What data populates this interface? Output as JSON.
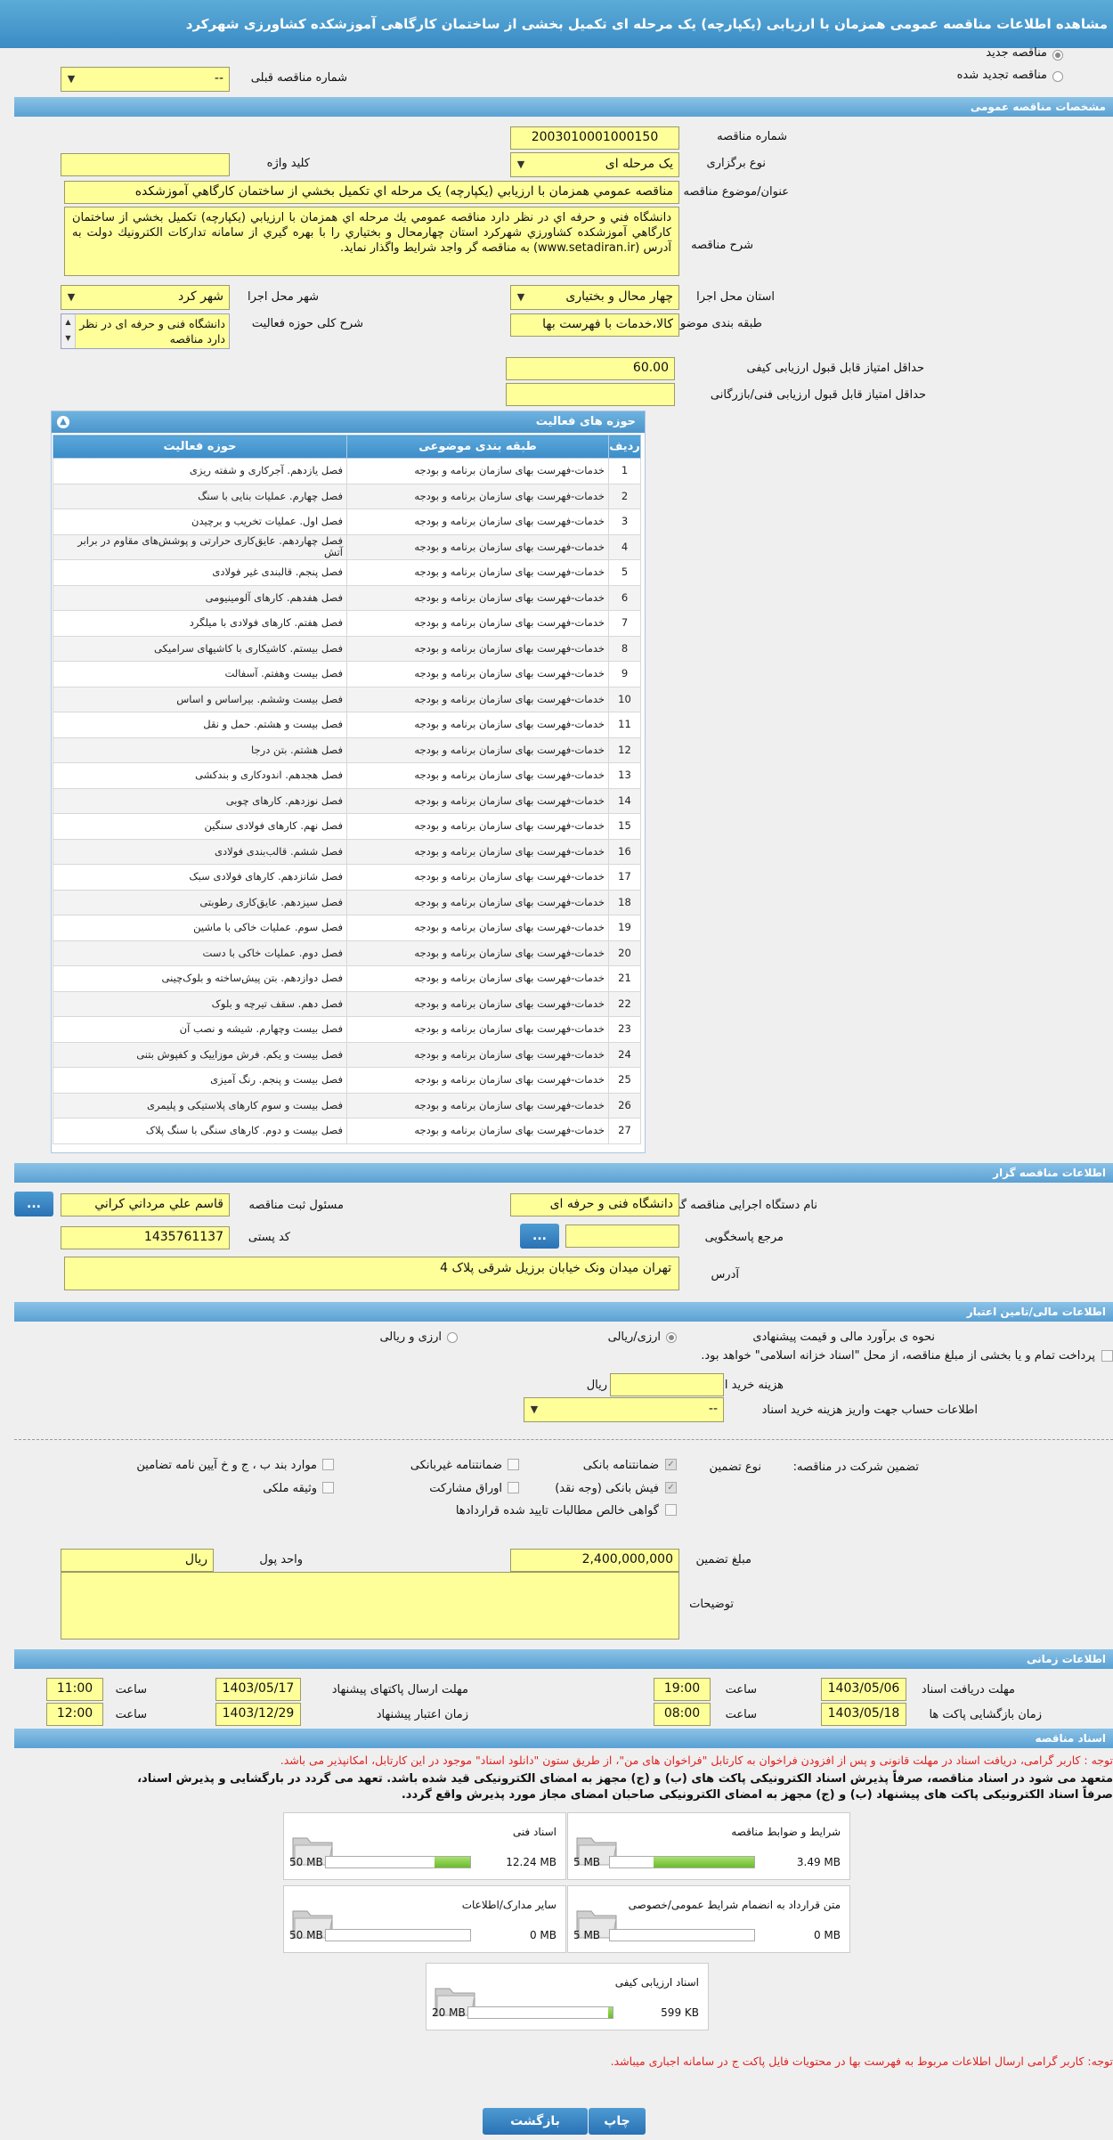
{
  "title": "مشاهده اطلاعات مناقصه عمومی همزمان با ارزیابی (یکپارچه) یک مرحله ای تکمیل بخشی از ساختمان کارگاهی آموزشکده کشاورزی شهرکرد",
  "top": {
    "new_tender": "مناقصه جدید",
    "renewed_tender": "مناقصه تجدید شده",
    "prev_number_label": "شماره مناقصه قبلی",
    "prev_number_value": "--"
  },
  "sections": {
    "general": "مشخصات مناقصه عمومی",
    "organizer": "اطلاعات مناقصه گزار",
    "finance": "اطلاعات مالی/تامین اعتبار",
    "time": "اطلاعات زمانی",
    "docs": "اسناد مناقصه"
  },
  "general": {
    "number_label": "شماره مناقصه",
    "number_value": "2003010001000150",
    "type_label": "نوع برگزاری",
    "type_value": "یک مرحله ای",
    "keyword_label": "کلید واژه",
    "keyword_value": "",
    "subject_label": "عنوان/موضوع مناقصه",
    "subject_value": "مناقصه عمومي همزمان با ارزيابي (يكپارچه) يک مرحله اي تكميل بخشي از ساختمان كارگاهي آموزشكده",
    "desc_label": "شرح مناقصه",
    "desc_value": "دانشگاه فني و حرفه اي  در نظر  دارد  مناقصه عمومي  يك  مرحله اي  همزمان  با  ارزيابي  (يكپارچه)  تكميل بخشي از ساختمان كارگاهي آموزشكده كشاورزي شهركرد استان چهارمحال و بختياري را با بهره گيري از سامانه تداركات الكترونيك دولت به آدرس (www.setadiran.ir) به مناقصه گر واجد شرايط واگذار نمايد.",
    "province_label": "استان محل اجرا",
    "province_value": "چهار محال و بختیاری",
    "city_label": "شهر محل اجرا",
    "city_value": "شهر کرد",
    "category_label": "طبقه بندی موضوعی",
    "category_value": "کالا،خدمات با فهرست بها",
    "scope_label": "شرح کلی حوزه فعالیت",
    "scope_value": "دانشگاه فنی و حرفه ای  در نظر  دارد  مناقصه",
    "min_quality_label": "حداقل امتیاز قابل قبول ارزیابی کیفی",
    "min_quality_value": "60.00",
    "min_tech_label": "حداقل امتیاز قابل قبول ارزیابی فنی/بازرگانی",
    "min_tech_value": ""
  },
  "activity": {
    "title": "حوزه های فعالیت",
    "headers": [
      "ردیف",
      "طبقه بندی موضوعی",
      "حوزه فعالیت"
    ],
    "category": "خدمات-فهرست بهای سازمان برنامه و بودجه",
    "rows": [
      {
        "n": "1",
        "area": "فصل یازدهم. آجرکاری و شفته ریزی"
      },
      {
        "n": "2",
        "area": "فصل چهارم. عملیات بنایی با سنگ"
      },
      {
        "n": "3",
        "area": "فصل اول. عملیات تخریب و برچیدن"
      },
      {
        "n": "4",
        "area": "فصل چهاردهم. عایق‌کاری حرارتی و پوشش‌های مقاوم در برابر آتش"
      },
      {
        "n": "5",
        "area": "فصل پنجم. قالبندی غیر فولادی"
      },
      {
        "n": "6",
        "area": "فصل هفدهم. کارهای آلومینیومی"
      },
      {
        "n": "7",
        "area": "فصل هفتم. کارهای فولادی با میلگرد"
      },
      {
        "n": "8",
        "area": "فصل بیستم. کاشیکاری با کاشیهای سرامیکی"
      },
      {
        "n": "9",
        "area": "فصل بیست وهفتم. آسفالت"
      },
      {
        "n": "10",
        "area": "فصل بیست وششم. بیراساس و اساس"
      },
      {
        "n": "11",
        "area": "فصل بیست و هشتم. حمل و نقل"
      },
      {
        "n": "12",
        "area": "فصل هشتم. بتن درجا"
      },
      {
        "n": "13",
        "area": "فصل هجدهم. اندودکاری و بندکشی"
      },
      {
        "n": "14",
        "area": "فصل نوزدهم. کارهای چوبی"
      },
      {
        "n": "15",
        "area": "فصل نهم. کارهای فولادی سنگین"
      },
      {
        "n": "16",
        "area": "فصل ششم. قالب‌بندی فولادی"
      },
      {
        "n": "17",
        "area": "فصل شانزدهم. کارهای فولادی سبک"
      },
      {
        "n": "18",
        "area": "فصل سیزدهم. عایق‌کاری رطوبتی"
      },
      {
        "n": "19",
        "area": "فصل سوم. عملیات خاکی با ماشین"
      },
      {
        "n": "20",
        "area": "فصل دوم. عملیات خاکی با دست"
      },
      {
        "n": "21",
        "area": "فصل دوازدهم. بتن پیش‌ساخته و بلوک‌چینی"
      },
      {
        "n": "22",
        "area": "فصل دهم. سقف تیرچه و بلوک"
      },
      {
        "n": "23",
        "area": "فصل بیست وچهارم. شیشه و نصب آن"
      },
      {
        "n": "24",
        "area": "فصل بیست و یکم. فرش موزاییک و کفپوش بتنی"
      },
      {
        "n": "25",
        "area": "فصل بیست و پنجم. رنگ آمیزی"
      },
      {
        "n": "26",
        "area": "فصل بیست و سوم کارهای پلاستیکی و پلیمری"
      },
      {
        "n": "27",
        "area": "فصل بیست و دوم. کارهای سنگی با سنگ پلاک"
      }
    ]
  },
  "organizer": {
    "org_label": "نام دستگاه اجرایی مناقصه گزار",
    "org_value": "دانشگاه فنی و حرفه ای",
    "reg_label": "مسئول ثبت مناقصه",
    "reg_value": "قاسم علي مرداني كراني",
    "ref_label": "مرجع پاسخگویی",
    "ref_value": "",
    "postal_label": "کد پستی",
    "postal_value": "1435761137",
    "address_label": "آدرس",
    "address_value": "تهران میدان ونک خیابان برزیل شرقی پلاک 4",
    "dots": "..."
  },
  "finance": {
    "estimate_label": "نحوه ی برآورد مالی و قیمت پیشنهادی",
    "opt1": "ارزی/ریالی",
    "opt2": "ارزی و ریالی",
    "payment_text": "پرداخت تمام و یا بخشی از مبلغ مناقصه، از محل \"اسناد خزانه اسلامی\" خواهد بود.",
    "doc_cost_label": "هزینه خرید اسناد",
    "doc_cost_unit": "ریال",
    "account_label": "اطلاعات حساب جهت واریز هزینه خرید اسناد",
    "account_value": "--",
    "guarantee_label": "تضمین شرکت در مناقصه:",
    "guarantee_type_label": "نوع تضمین",
    "g1": "ضمانتنامه بانکی",
    "g2": "ضمانتنامه غیربانکی",
    "g3": "موارد بند ب ، ج و خ آیین نامه تضامین",
    "g4": "فیش بانکی (وجه نقد)",
    "g5": "اوراق مشارکت",
    "g6": "وثیقه ملکی",
    "g7": "گواهی خالص مطالبات تایید شده قراردادها",
    "amount_label": "مبلغ تضمین",
    "amount_value": "2,400,000,000",
    "currency_label": "واحد پول",
    "currency_value": "ریال",
    "notes_label": "توضیحات",
    "notes_value": ""
  },
  "time": {
    "recv_label": "مهلت دریافت اسناد",
    "recv_date": "1403/05/06",
    "recv_time": "19:00",
    "send_label": "مهلت ارسال پاکتهای پیشنهاد",
    "send_date": "1403/05/17",
    "send_time": "11:00",
    "open_label": "زمان بازگشایی پاکت ها",
    "open_date": "1403/05/18",
    "open_time": "08:00",
    "valid_label": "زمان اعتبار پیشنهاد",
    "valid_date": "1403/12/29",
    "valid_time": "12:00",
    "time_label": "ساعت"
  },
  "docs": {
    "note1": "توجه : کاربر گرامی، دریافت اسناد در مهلت قانونی و پس از افزودن فراخوان به کارتابل \"فراخوان های من\"، از طریق ستون \"دانلود اسناد\" موجود در این کارتابل، امکانپذیر می باشد.",
    "note2": "متعهد می شود در اسناد مناقصه، صرفاً پذیرش اسناد الکترونیکی پاکت های (ب) و (ج) مجهز به امضای الکترونیکی قید شده باشد. تعهد می گردد در بارگشایی و پذیرش اسناد،",
    "note3": "صرفاً اسناد الکترونیکی پاکت های پیشنهاد (ب) و (ج) مجهز به امضای الکترونیکی صاحبان امضای مجاز مورد پذیرش واقع گردد.",
    "files": [
      {
        "name": "شرایط و ضوابط مناقصه",
        "size": "3.49 MB",
        "max": "5 MB",
        "fraction": 0.7
      },
      {
        "name": "اسناد فنی",
        "size": "12.24 MB",
        "max": "50 MB",
        "fraction": 0.245
      },
      {
        "name": "متن قرارداد به انضمام شرایط عمومی/خصوصی",
        "size": "0 MB",
        "max": "5 MB",
        "fraction": 0
      },
      {
        "name": "سایر مدارک/اطلاعات",
        "size": "0 MB",
        "max": "50 MB",
        "fraction": 0
      },
      {
        "name": "اسناد ارزیابی کیفی",
        "size": "599 KB",
        "max": "20 MB",
        "fraction": 0.03
      }
    ],
    "note4": "توجه: کاربر گرامی ارسال اطلاعات مربوط به فهرست بها در محتویات فایل پاکت ج در سامانه اجباری میباشد."
  },
  "buttons": {
    "print": "چاپ",
    "back": "بازگشت"
  },
  "colors": {
    "accent": "#4a95cc",
    "field": "#ffff9a",
    "progress": "#6cbb2a",
    "note": "#e0231f"
  }
}
